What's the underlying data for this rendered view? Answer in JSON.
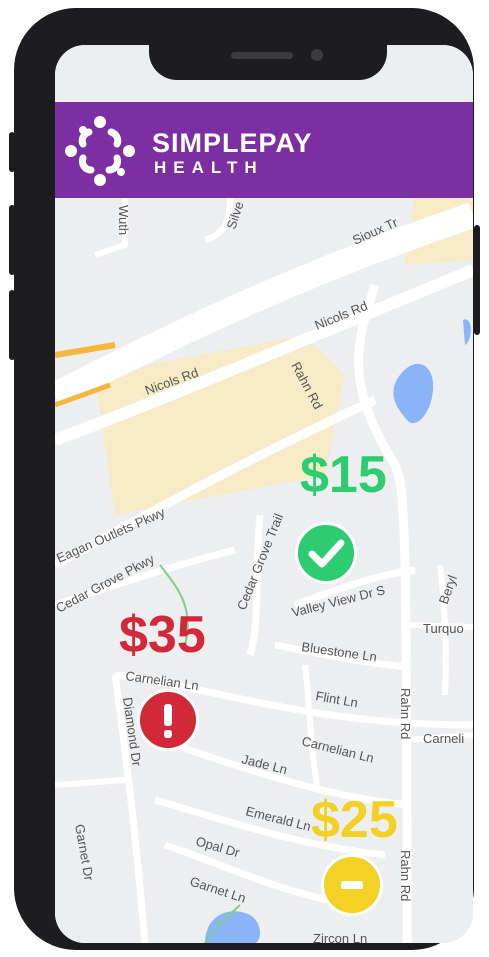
{
  "brand": {
    "name_line1": "SIMPLEPAY",
    "name_line2": "HEALTH"
  },
  "map": {
    "labels": {
      "sioux": "Sioux Tr",
      "nicols_upper": "Nicols Rd",
      "nicols_lower": "Nicols Rd",
      "rahn_upper": "Rahn Rd",
      "eagan_outlets": "Eagan Outlets Pkwy",
      "cedar_grove_pkwy": "Cedar Grove Pkwy",
      "cedar_grove_trail": "Cedar Grove Trail",
      "valley_view": "Valley View Dr S",
      "bluestone": "Bluestone Ln",
      "turquoise": "Turquo",
      "carnelian_left": "Carnelian Ln",
      "flint": "Flint Ln",
      "carnelian_mid": "Carnelian Ln",
      "carnelian_right": "Carneli",
      "rahn_mid": "Rahn Rd",
      "rahn_lower": "Rahn Rd",
      "diamond": "Diamond Dr",
      "jade": "Jade Ln",
      "emerald": "Emerald Ln",
      "opal": "Opal Dr",
      "garnet_dr": "Garnet Dr",
      "garnet_ln": "Garnet Ln",
      "wuth": "Wuth",
      "silver": "Silve",
      "beryl": "Beryl",
      "zircon": "Zircon Ln"
    }
  },
  "markers": [
    {
      "price": "$15",
      "status": "ok",
      "icon": "check-icon",
      "color": "#2ecc71"
    },
    {
      "price": "$35",
      "status": "alert",
      "icon": "exclamation-icon",
      "color": "#d2283a"
    },
    {
      "price": "$25",
      "status": "neutral",
      "icon": "minus-icon",
      "color": "#f2d024"
    }
  ],
  "colors": {
    "header": "#7b2fa3",
    "phone": "#1d1d1f"
  }
}
